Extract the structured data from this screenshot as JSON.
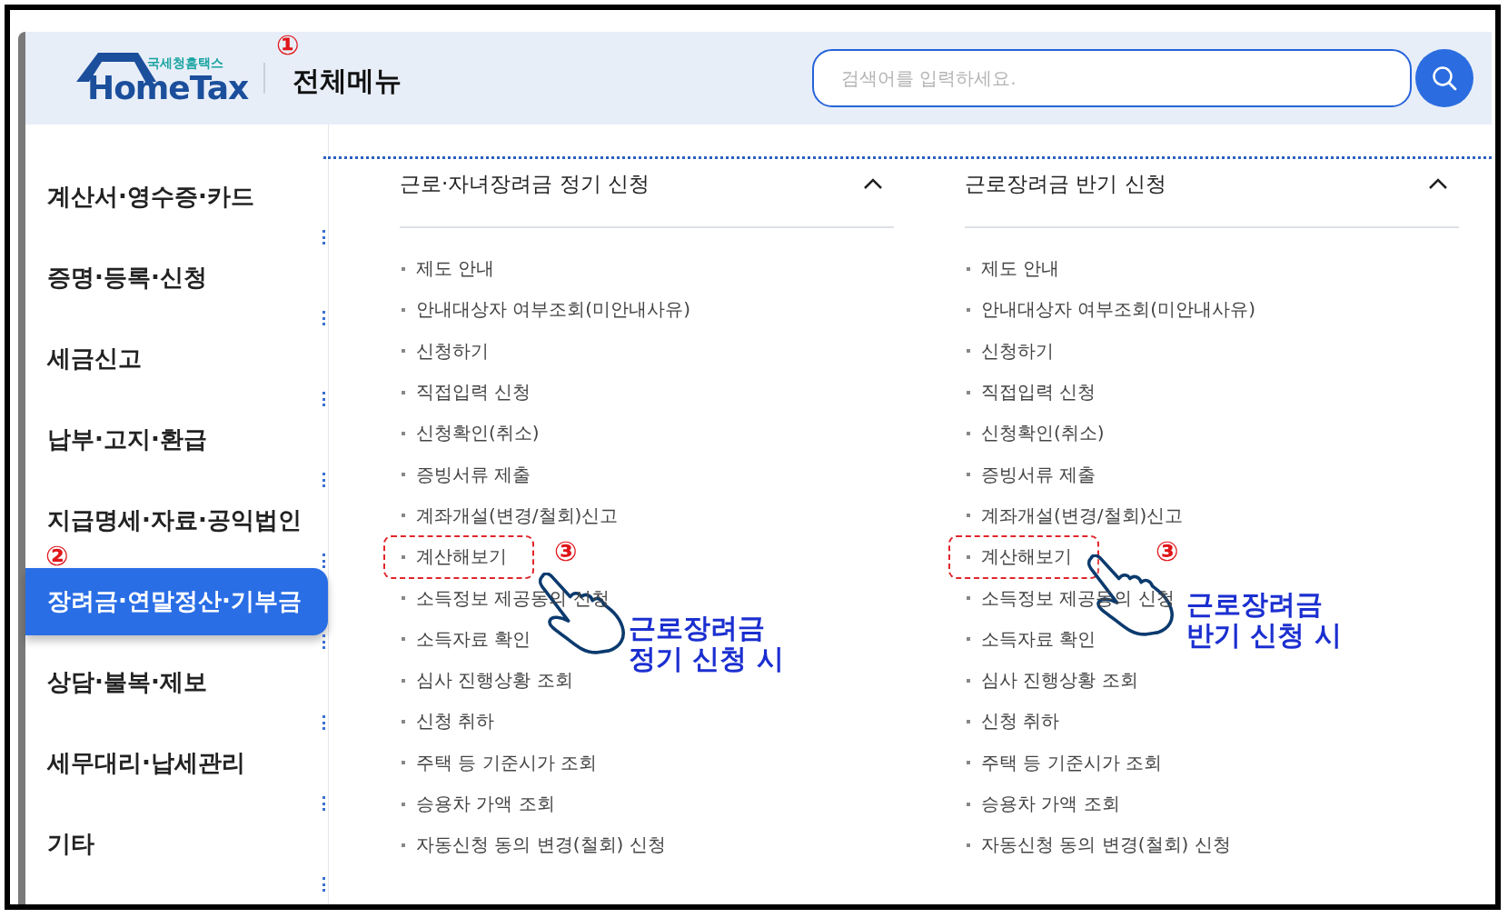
{
  "header": {
    "logo_caption": "국세청홈택스",
    "logo_text": "HomeTax",
    "title": "전체메뉴",
    "title_marker": "①",
    "search": {
      "placeholder": "검색어를 입력하세요."
    }
  },
  "sidebar": {
    "marker": "②",
    "items": [
      {
        "label": "계산서·영수증·카드",
        "selected": false
      },
      {
        "label": "증명·등록·신청",
        "selected": false
      },
      {
        "label": "세금신고",
        "selected": false
      },
      {
        "label": "납부·고지·환급",
        "selected": false
      },
      {
        "label": "지급명세·자료·공익법인",
        "selected": false
      },
      {
        "label": "장려금·연말정산·기부금",
        "selected": true
      },
      {
        "label": "상담·불복·제보",
        "selected": false
      },
      {
        "label": "세무대리·납세관리",
        "selected": false
      },
      {
        "label": "기타",
        "selected": false
      }
    ]
  },
  "columns": [
    {
      "title": "근로·자녀장려금 정기 신청",
      "expanded": true,
      "annotation": {
        "marker": "③",
        "text": "근로장려금\n정기 신청 시"
      },
      "items": [
        {
          "label": "제도 안내",
          "highlighted": false
        },
        {
          "label": "안내대상자 여부조회(미안내사유)",
          "highlighted": false
        },
        {
          "label": "신청하기",
          "highlighted": false
        },
        {
          "label": "직접입력 신청",
          "highlighted": false
        },
        {
          "label": "신청확인(취소)",
          "highlighted": false
        },
        {
          "label": "증빙서류 제출",
          "highlighted": false
        },
        {
          "label": "계좌개설(변경/철회)신고",
          "highlighted": false
        },
        {
          "label": "계산해보기",
          "highlighted": true
        },
        {
          "label": "소득정보 제공동의 신청",
          "highlighted": false
        },
        {
          "label": "소득자료 확인",
          "highlighted": false
        },
        {
          "label": "심사 진행상황 조회",
          "highlighted": false
        },
        {
          "label": "신청 취하",
          "highlighted": false
        },
        {
          "label": "주택 등 기준시가 조회",
          "highlighted": false
        },
        {
          "label": "승용차 가액 조회",
          "highlighted": false
        },
        {
          "label": "자동신청 동의 변경(철회) 신청",
          "highlighted": false
        }
      ]
    },
    {
      "title": "근로장려금 반기 신청",
      "expanded": true,
      "annotation": {
        "marker": "③",
        "text": "근로장려금\n반기 신청 시"
      },
      "items": [
        {
          "label": "제도 안내",
          "highlighted": false
        },
        {
          "label": "안내대상자 여부조회(미안내사유)",
          "highlighted": false
        },
        {
          "label": "신청하기",
          "highlighted": false
        },
        {
          "label": "직접입력 신청",
          "highlighted": false
        },
        {
          "label": "신청확인(취소)",
          "highlighted": false
        },
        {
          "label": "증빙서류 제출",
          "highlighted": false
        },
        {
          "label": "계좌개설(변경/철회)신고",
          "highlighted": false
        },
        {
          "label": "계산해보기",
          "highlighted": true
        },
        {
          "label": "소득정보 제공동의 신청",
          "highlighted": false
        },
        {
          "label": "소득자료 확인",
          "highlighted": false
        },
        {
          "label": "심사 진행상황 조회",
          "highlighted": false
        },
        {
          "label": "신청 취하",
          "highlighted": false
        },
        {
          "label": "주택 등 기준시가 조회",
          "highlighted": false
        },
        {
          "label": "승용차 가액 조회",
          "highlighted": false
        },
        {
          "label": "자동신청 동의 변경(철회) 신청",
          "highlighted": false
        }
      ]
    }
  ]
}
